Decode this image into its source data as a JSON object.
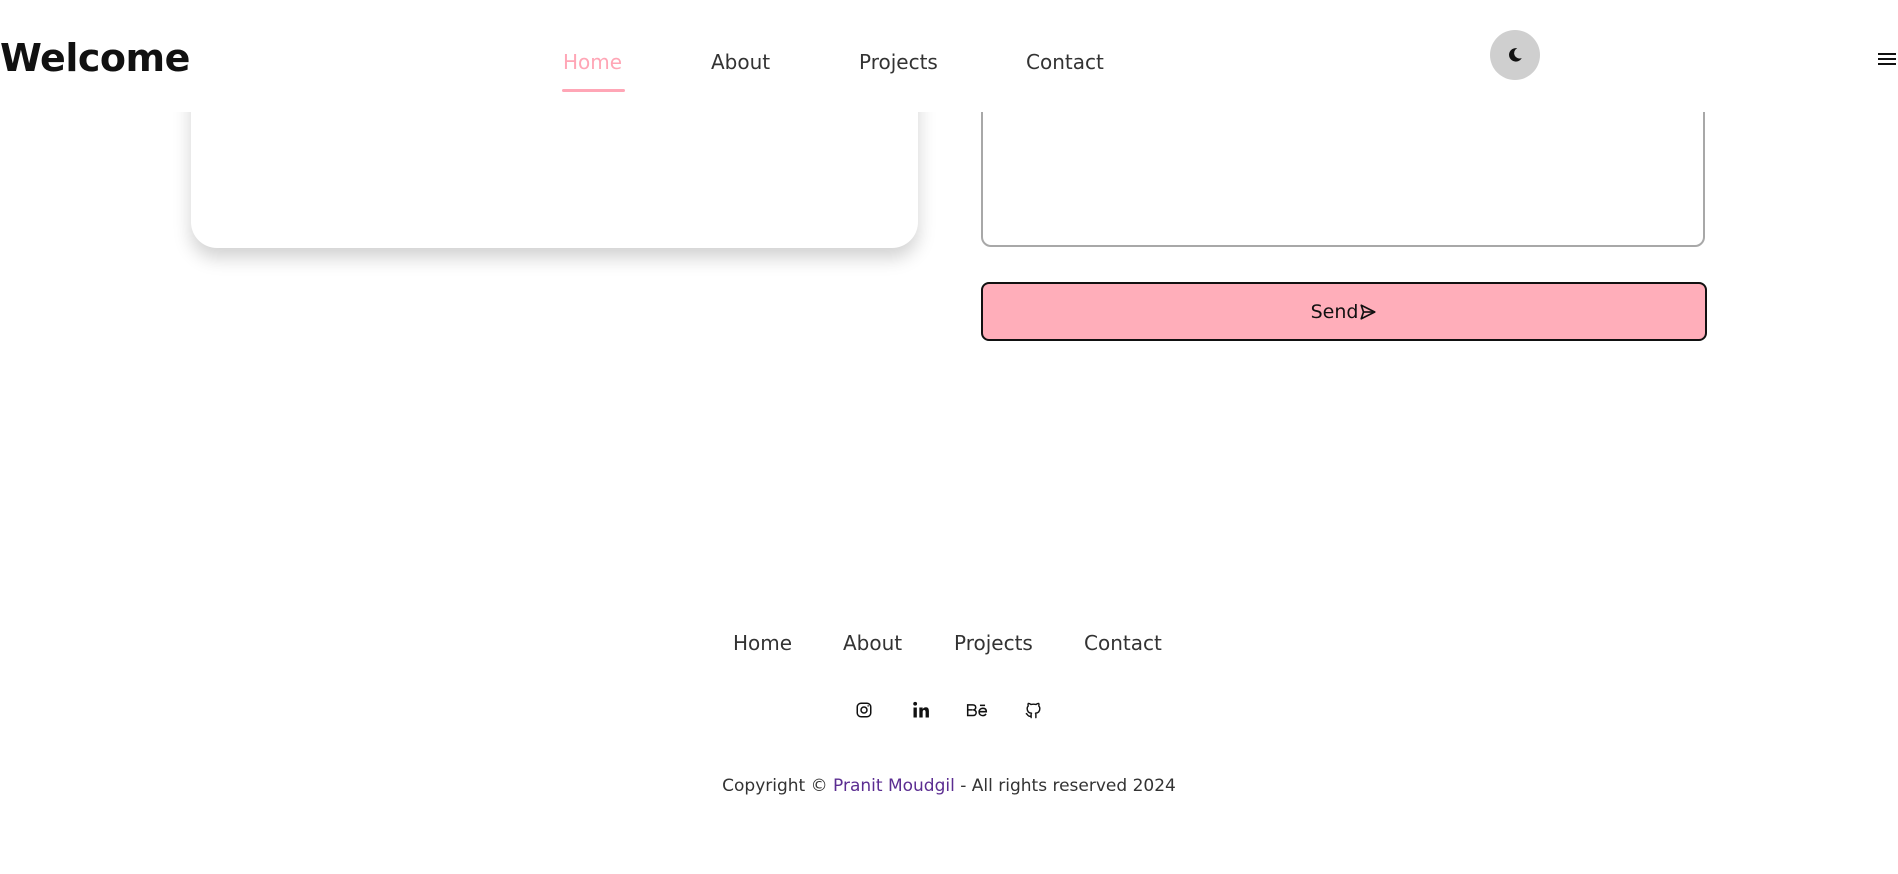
{
  "header": {
    "brand": "Welcome",
    "nav": [
      "Home",
      "About",
      "Projects",
      "Contact"
    ],
    "active_nav": "Home",
    "theme_toggle_icon": "moon-icon",
    "menu_icon": "hamburger-icon"
  },
  "contact": {
    "send_label": "Send",
    "send_icon": "send-icon"
  },
  "footer": {
    "nav": [
      "Home",
      "About",
      "Projects",
      "Contact"
    ],
    "social": [
      "instagram-icon",
      "linkedin-icon",
      "behance-icon",
      "github-icon"
    ],
    "copyright_prefix": "Copyright ©",
    "author": "Pranit Moudgil",
    "copyright_suffix": "- All rights reserved 2024"
  },
  "colors": {
    "accent": "#ffa6b6",
    "send_button": "#ffaeba",
    "author_link": "#5b2d91",
    "toggle_bg": "#cfcfcf"
  }
}
